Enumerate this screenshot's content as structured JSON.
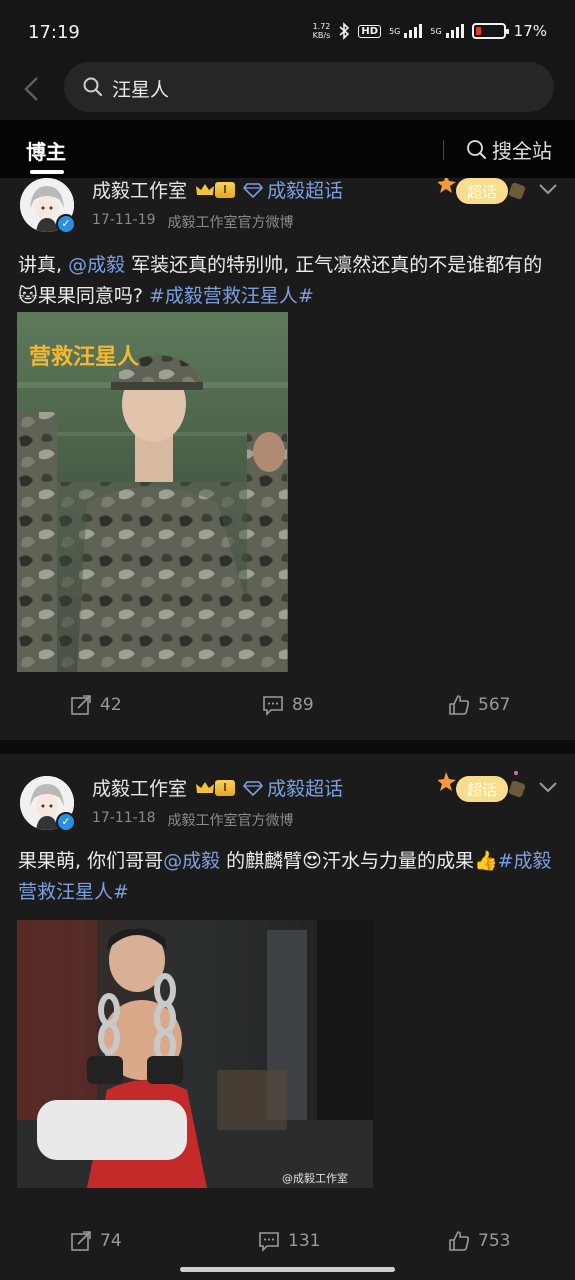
{
  "status_bar": {
    "time": "17:19",
    "net_speed_value": "1.72",
    "net_speed_unit": "KB/s",
    "hd_label": "HD",
    "signal_tag": "5G",
    "battery": "17%"
  },
  "search": {
    "query": "汪星人"
  },
  "tabs": {
    "active": "博主",
    "search_all": "搜全站"
  },
  "posts": [
    {
      "username": "成毅工作室",
      "level": "I",
      "supertopic": "成毅超话",
      "chaohua_label": "超话",
      "date": "17-11-19",
      "source": "成毅工作室官方微博",
      "text_before": "讲真, ",
      "mention": "@成毅",
      "text_middle": " 军装还真的特别帅, 正气凛然还真的不是谁都有的",
      "emoji": "🐱",
      "text_after": "果果同意吗? ",
      "hashtag": "#成毅营救汪星人#",
      "poster_text": "营救汪星人",
      "reposts": "42",
      "comments": "89",
      "likes": "567"
    },
    {
      "username": "成毅工作室",
      "level": "I",
      "supertopic": "成毅超话",
      "chaohua_label": "超话",
      "date": "17-11-18",
      "source": "成毅工作室官方微博",
      "text_before": "果果萌, 你们哥哥",
      "mention": "@成毅",
      "text_middle": " 的麒麟臂",
      "emoji": "😍",
      "text_after": "汗水与力量的成果👍",
      "hashtag": "#成毅营救汪星人#",
      "watermark": "@成毅工作室",
      "reposts": "74",
      "comments": "131",
      "likes": "753"
    }
  ],
  "colors": {
    "link": "#7b9fe0",
    "background": "#1b1b1b",
    "verified": "#2a8fe0"
  }
}
